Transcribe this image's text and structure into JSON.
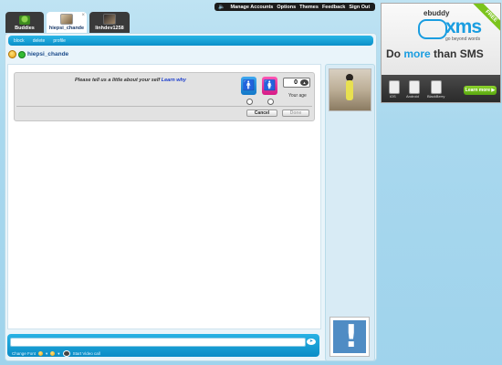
{
  "topbar": {
    "sound_icon": "speaker-icon",
    "items": [
      "Manage Accounts",
      "Options",
      "Themes",
      "Feedback",
      "Sign Out"
    ]
  },
  "tabs": [
    {
      "label": "Buddies",
      "icon": "buddies-icon",
      "active": false
    },
    {
      "label": "hiepsi_chande",
      "icon": "avatar-photo",
      "active": true,
      "close": "×"
    },
    {
      "label": "linhdev1258",
      "icon": "avatar-photo",
      "active": false
    }
  ],
  "actionbar": {
    "items": [
      "block",
      "delete",
      "profile"
    ]
  },
  "chat": {
    "username": "hiepsi_chande",
    "profile_prompt": {
      "text": "Please tell us a little about your self",
      "link": "Learn why",
      "age_value": "0",
      "age_label": "Your age",
      "cancel_label": "Cancel",
      "done_label": "Done"
    }
  },
  "input": {
    "change_font_label": "Change Font",
    "video_call_label": "Start Video call"
  },
  "ad": {
    "brand": "ebuddy",
    "product": "xms",
    "tagline": "go beyond words",
    "free_badge": "FREE",
    "headline_a": "Do",
    "headline_more": "more",
    "headline_b": "than SMS",
    "platforms": [
      "iOS",
      "Android",
      "BlackBerry"
    ],
    "cta": "Learn more"
  },
  "colors": {
    "accent": "#0a8fc8",
    "brand": "#1a9de0",
    "male": "#1277c8",
    "female": "#d61a86"
  }
}
